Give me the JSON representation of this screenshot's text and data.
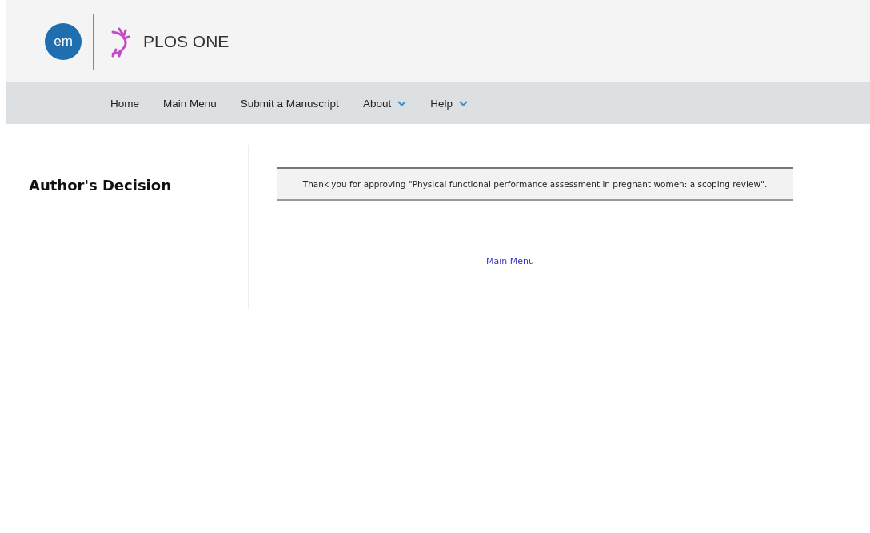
{
  "header": {
    "logo_badge": "em",
    "journal": "PLOS ONE"
  },
  "nav": [
    {
      "label": "Home",
      "kind": "link"
    },
    {
      "label": "Main Menu",
      "kind": "link"
    },
    {
      "label": "Submit a Manuscript",
      "kind": "link"
    },
    {
      "label": "About",
      "kind": "dropdown"
    },
    {
      "label": "Help",
      "kind": "dropdown"
    }
  ],
  "sidebar": {
    "title": "Author's Decision"
  },
  "message": "Thank you for approving \"Physical functional performance assessment in pregnant women: a scoping review\".",
  "link": "Main Menu"
}
